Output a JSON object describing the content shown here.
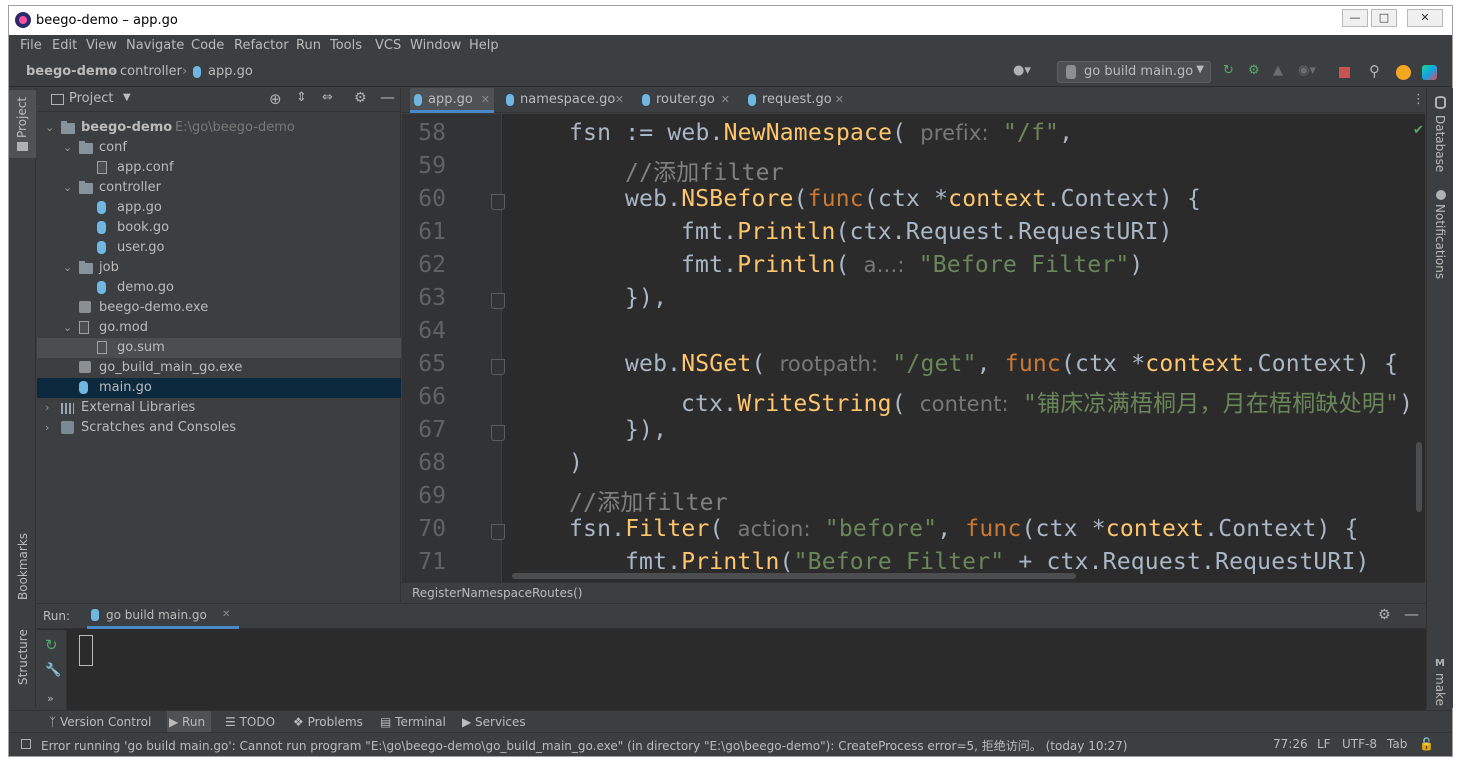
{
  "window": {
    "title": "beego-demo – app.go",
    "controls": [
      "minimize-icon",
      "maximize-icon",
      "close-icon"
    ]
  },
  "menu": [
    "File",
    "Edit",
    "View",
    "Navigate",
    "Code",
    "Refactor",
    "Run",
    "Tools",
    "VCS",
    "Window",
    "Help"
  ],
  "nav": {
    "project": "beego-demo",
    "folder": "controller",
    "file": "app.go",
    "run_config": "go build main.go"
  },
  "project_panel": {
    "title": "Project",
    "tree": [
      {
        "label": "beego-demo",
        "extra": "E:\\go\\beego-demo",
        "type": "folder",
        "depth": 0,
        "expanded": true
      },
      {
        "label": "conf",
        "type": "folder",
        "depth": 1,
        "expanded": true
      },
      {
        "label": "app.conf",
        "type": "file",
        "depth": 2
      },
      {
        "label": "controller",
        "type": "folder",
        "depth": 1,
        "expanded": true
      },
      {
        "label": "app.go",
        "type": "gofile",
        "depth": 2
      },
      {
        "label": "book.go",
        "type": "gofile",
        "depth": 2
      },
      {
        "label": "user.go",
        "type": "gofile",
        "depth": 2
      },
      {
        "label": "job",
        "type": "folder",
        "depth": 1,
        "expanded": true
      },
      {
        "label": "demo.go",
        "type": "gofile",
        "depth": 2
      },
      {
        "label": "beego-demo.exe",
        "type": "exe",
        "depth": 1
      },
      {
        "label": "go.mod",
        "type": "file",
        "depth": 1,
        "expanded": true
      },
      {
        "label": "go.sum",
        "type": "file",
        "depth": 2,
        "highlight": true
      },
      {
        "label": "go_build_main_go.exe",
        "type": "exe",
        "depth": 1
      },
      {
        "label": "main.go",
        "type": "gofile",
        "depth": 1,
        "selected": true
      },
      {
        "label": "External Libraries",
        "type": "lib",
        "depth": 0,
        "collapsed": true
      },
      {
        "label": "Scratches and Consoles",
        "type": "scratch",
        "depth": 0,
        "collapsed": true
      }
    ]
  },
  "editor_tabs": [
    {
      "label": "app.go",
      "active": true
    },
    {
      "label": "namespace.go"
    },
    {
      "label": "router.go"
    },
    {
      "label": "request.go"
    }
  ],
  "editor": {
    "line_numbers": [
      "58",
      "59",
      "60",
      "61",
      "62",
      "63",
      "64",
      "65",
      "66",
      "67",
      "68",
      "69",
      "70",
      "71"
    ],
    "hints": {
      "prefix": "prefix:",
      "a": "a...:",
      "rootpath": "rootpath:",
      "content": "content:",
      "action": "action:"
    },
    "strings": {
      "f": "\"/f\"",
      "before_filter": "\"Before Filter\"",
      "get": "\"/get\"",
      "poem": "\"铺床凉满梧桐月，月在梧桐缺处明\"",
      "before": "\"before\""
    },
    "comment": "//添加filter",
    "breadcrumb": "RegisterNamespaceRoutes()"
  },
  "run_panel": {
    "label": "Run:",
    "tab": "go build main.go"
  },
  "tool_windows": [
    "Version Control",
    "Run",
    "TODO",
    "Problems",
    "Terminal",
    "Services"
  ],
  "left_stripe": [
    "Project",
    "Bookmarks",
    "Structure"
  ],
  "right_stripe": [
    "Database",
    "Notifications",
    "make"
  ],
  "status": {
    "message": "Error running 'go build main.go': Cannot run program \"E:\\go\\beego-demo\\go_build_main_go.exe\" (in directory \"E:\\go\\beego-demo\"): CreateProcess error=5, 拒绝访问。 (today 10:27)",
    "position": "77:26",
    "line_sep": "LF",
    "encoding": "UTF-8",
    "indent": "Tab"
  }
}
